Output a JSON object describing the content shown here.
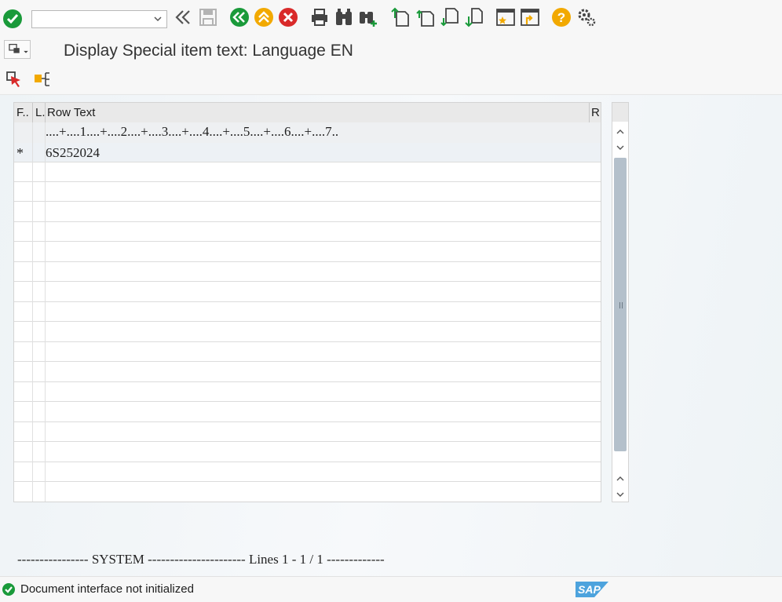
{
  "toolbar": {
    "command_field_value": "",
    "icons": [
      "enter-check-icon",
      "back-double-chevron-icon",
      "save-icon",
      "back-green-icon",
      "exit-up-icon",
      "cancel-icon",
      "print-icon",
      "find-icon",
      "find-next-icon",
      "first-page-icon",
      "previous-page-icon",
      "next-page-icon",
      "last-page-icon",
      "create-session-icon",
      "generate-shortcut-icon",
      "help-icon",
      "customize-layout-icon"
    ]
  },
  "titlebar": {
    "title": "Display Special item text: Language EN"
  },
  "grid": {
    "columns": [
      {
        "label": "F.."
      },
      {
        "label": "L."
      },
      {
        "label": "Row Text"
      },
      {
        "label": "R"
      }
    ],
    "ruler": "....+....1....+....2....+....3....+....4....+....5....+....6....+....7..",
    "rows": [
      {
        "marker": "*",
        "text": "6S252024"
      }
    ]
  },
  "footer": {
    "system_line": "---------------- SYSTEM ---------------------- Lines 1 - 1 / 1 -------------"
  },
  "status": {
    "message": "Document interface not initialized"
  },
  "colors": {
    "green": "#1a9a3a",
    "red": "#d92a2a",
    "yellow": "#f2a900",
    "accent_blue": "#2b6cb0"
  }
}
